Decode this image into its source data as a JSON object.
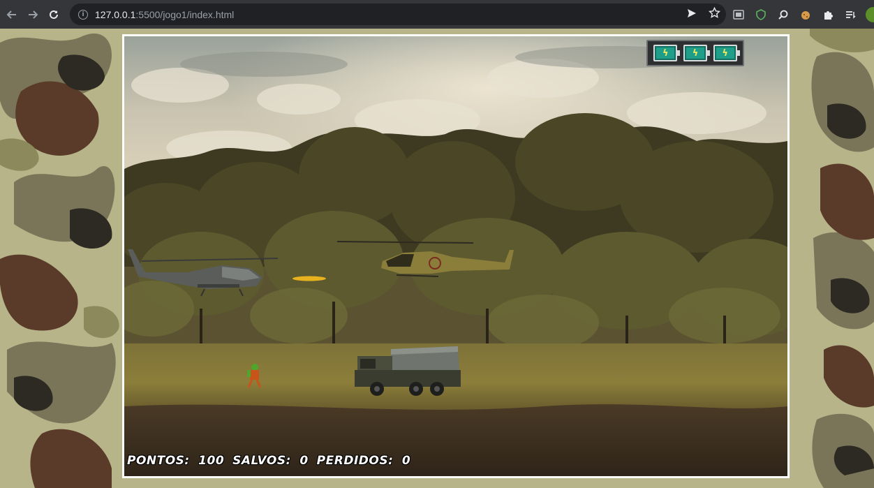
{
  "browser": {
    "url_host": "127.0.0.1",
    "url_rest": ":5500/jogo1/index.html"
  },
  "icons": {
    "back": "arrow-left",
    "forward": "arrow-right",
    "reload": "reload",
    "site_info": "info",
    "send": "send",
    "bookmark": "star",
    "extensions": [
      "image-ext",
      "shield-ext",
      "search-ext",
      "cookie-ext",
      "puzzle",
      "tab-list"
    ]
  },
  "game": {
    "energy_cells": 3,
    "score": {
      "pontos_label": "PONTOS:",
      "pontos_value": "100",
      "salvos_label": "SALVOS:",
      "salvos_value": "0",
      "perdidos_label": "PERDIDOS:",
      "perdidos_value": "0"
    }
  },
  "colors": {
    "frame_border": "#ffffff",
    "energy_cell": "#1f9e8a",
    "bolt": "#f2e85c"
  }
}
